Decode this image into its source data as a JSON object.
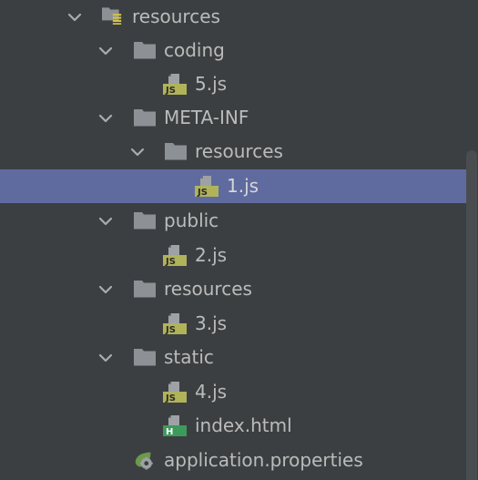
{
  "tree": {
    "items": [
      {
        "label": "resources",
        "icon": "resources-folder-icon",
        "expanded": true
      },
      {
        "label": "coding",
        "icon": "folder-icon",
        "expanded": true
      },
      {
        "label": "5.js",
        "icon": "js-file-icon"
      },
      {
        "label": "META-INF",
        "icon": "folder-icon",
        "expanded": true
      },
      {
        "label": "resources",
        "icon": "folder-icon",
        "expanded": true
      },
      {
        "label": "1.js",
        "icon": "js-file-icon",
        "selected": true
      },
      {
        "label": "public",
        "icon": "folder-icon",
        "expanded": true
      },
      {
        "label": "2.js",
        "icon": "js-file-icon"
      },
      {
        "label": "resources",
        "icon": "folder-icon",
        "expanded": true
      },
      {
        "label": "3.js",
        "icon": "js-file-icon"
      },
      {
        "label": "static",
        "icon": "folder-icon",
        "expanded": true
      },
      {
        "label": "4.js",
        "icon": "js-file-icon"
      },
      {
        "label": "index.html",
        "icon": "html-file-icon"
      },
      {
        "label": "application.properties",
        "icon": "spring-properties-icon"
      }
    ],
    "js_badge": "JS",
    "html_badge": "H"
  },
  "colors": {
    "background": "#3c3f41",
    "selection": "#5f6b9f",
    "text": "#bbbbbb",
    "folder": "#8c9196",
    "js_badge": "#b0b35a",
    "html_badge": "#3d9a5c",
    "spring": "#6a9a4c"
  }
}
